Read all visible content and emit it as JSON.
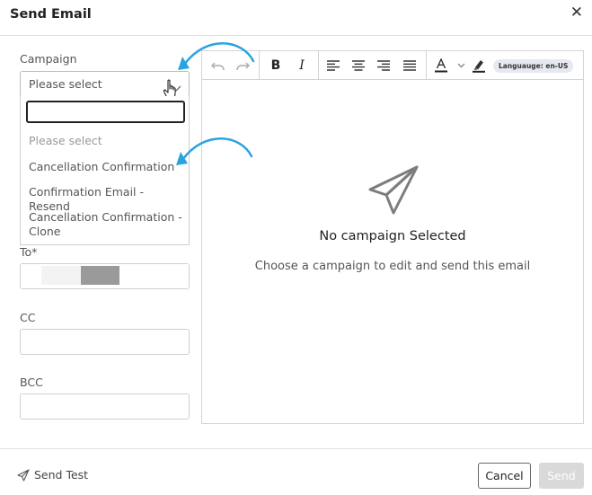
{
  "dialog": {
    "title": "Send Email",
    "close_icon": "close-icon"
  },
  "form": {
    "campaign_label": "Campaign",
    "campaign_value": "Please select",
    "dropdown_search_value": "",
    "options": [
      "Please select",
      "Cancellation Confirmation",
      "Confirmation Email - Resend",
      "Cancellation Confirmation - Clone"
    ],
    "to_label": "To*",
    "cc_label": "CC",
    "bcc_label": "BCC"
  },
  "editor": {
    "toolbar": [
      "undo-icon",
      "redo-icon",
      "bold-icon",
      "italic-icon",
      "align-left-icon",
      "align-center-icon",
      "align-right-icon",
      "align-justify-icon",
      "text-color-icon",
      "highlight-icon"
    ],
    "language_label": "Languauge: en-US",
    "empty_title": "No campaign Selected",
    "empty_subtitle": "Choose a campaign to edit and send this email"
  },
  "footer": {
    "send_test_label": "Send Test",
    "cancel_label": "Cancel",
    "send_label": "Send"
  },
  "colors": {
    "annotation_arrow": "#2aa3e0",
    "send_disabled": "#d9d9d9"
  }
}
